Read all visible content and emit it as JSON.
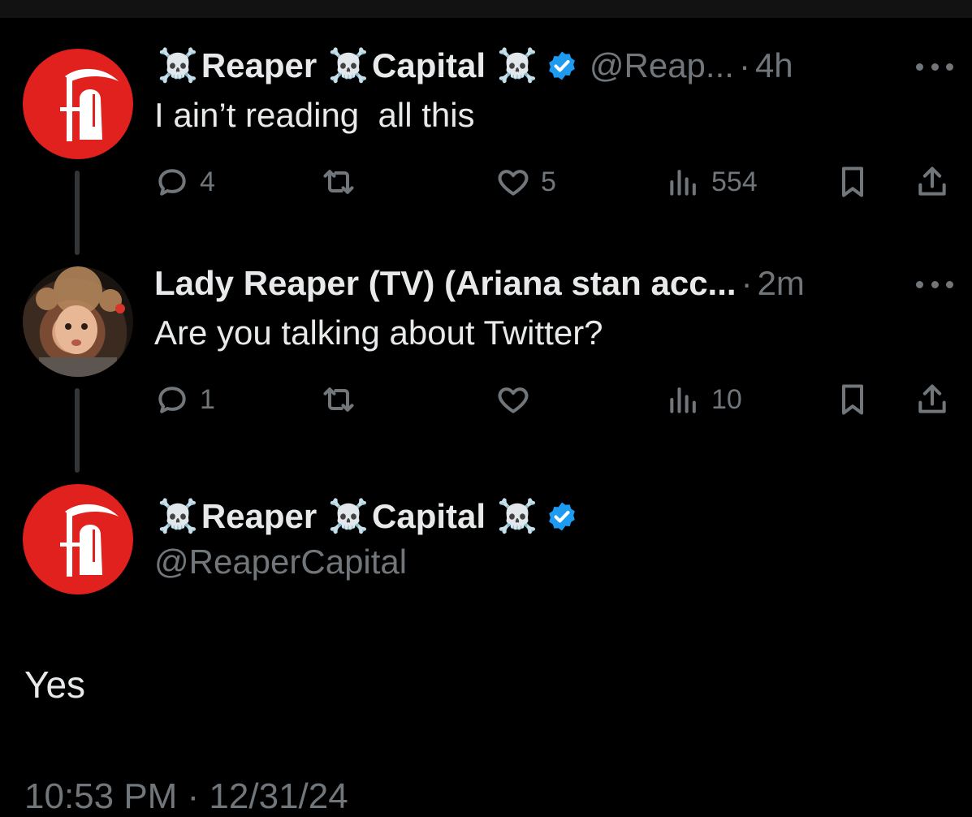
{
  "tweets": [
    {
      "author": {
        "name_part1": "Reaper",
        "name_part2": "Capital",
        "handle": "@Reap...",
        "verified": true
      },
      "time": "4h",
      "dot": "·",
      "text": "I ain’t reading  all this",
      "actions": {
        "replies": "4",
        "likes": "5",
        "views": "554"
      }
    },
    {
      "author": {
        "name": "Lady Reaper (TV) (Ariana stan acc...",
        "verified": false
      },
      "time": "2m",
      "dot": "·",
      "text": "Are you talking about Twitter?",
      "actions": {
        "replies": "1",
        "views": "10"
      }
    }
  ],
  "main_tweet": {
    "author": {
      "name_part1": "Reaper",
      "name_part2": "Capital",
      "handle": "@ReaperCapital",
      "verified": true
    },
    "text": "Yes",
    "timestamp_partial": "10:53 PM · 12/31/24"
  },
  "emoji": {
    "skull": "☠️"
  },
  "colors": {
    "background": "#000000",
    "text_primary": "#e7e9ea",
    "text_secondary": "#71767b",
    "verified_blue": "#1d9bf0",
    "avatar_red": "#e0211d",
    "thread_line": "#333639"
  },
  "icons": [
    "reply-icon",
    "retweet-icon",
    "like-icon",
    "views-icon",
    "bookmark-icon",
    "share-icon",
    "more-icon",
    "verified-badge-icon",
    "skull-emoji-icon"
  ]
}
